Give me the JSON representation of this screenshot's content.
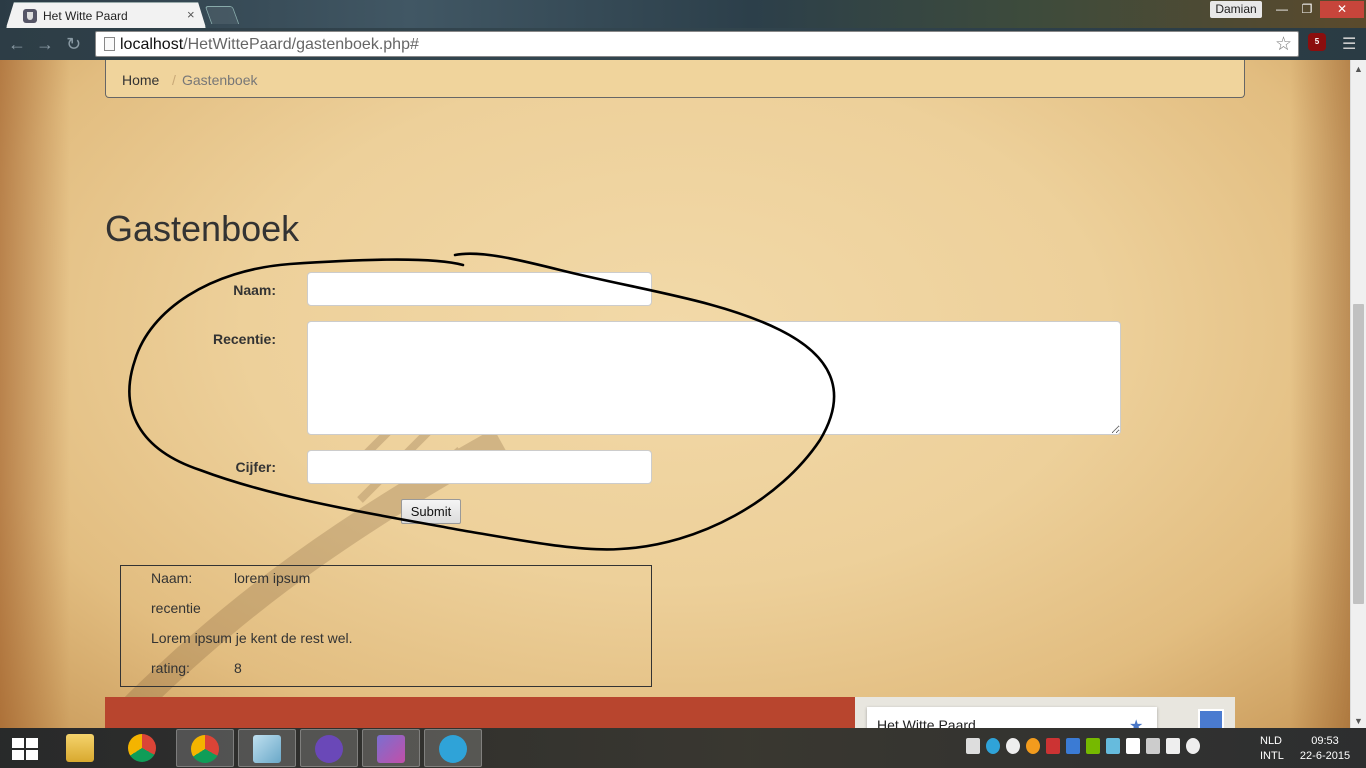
{
  "browser": {
    "tab_title": "Het Witte Paard",
    "tab_close": "×",
    "user": "Damian",
    "url_host": "localhost",
    "url_path": "/HetWittePaard/gastenboek.php#",
    "ublock_badge": "5"
  },
  "breadcrumb": {
    "home": "Home",
    "separator": "/",
    "current": "Gastenboek"
  },
  "page": {
    "title": "Gastenboek"
  },
  "form": {
    "naam_label": "Naam:",
    "recentie_label": "Recentie:",
    "cijfer_label": "Cijfer:",
    "naam_value": "",
    "recentie_value": "",
    "cijfer_value": "",
    "submit_label": "Submit"
  },
  "review": {
    "naam_label": "Naam:",
    "naam_value": "lorem ipsum",
    "recentie_label": "recentie",
    "recentie_text": "Lorem ipsum je kent de rest wel.",
    "rating_label": "rating:",
    "rating_value": "8"
  },
  "map": {
    "place_name": "Het Witte Paard"
  },
  "taskbar": {
    "language_top": "NLD",
    "language_bottom": "INTL",
    "time": "09:53",
    "date": "22-6-2015"
  },
  "colors": {
    "parchment": "#edd09a",
    "footer_red": "#b8452e",
    "accent_blue": "#4a7bd0"
  }
}
